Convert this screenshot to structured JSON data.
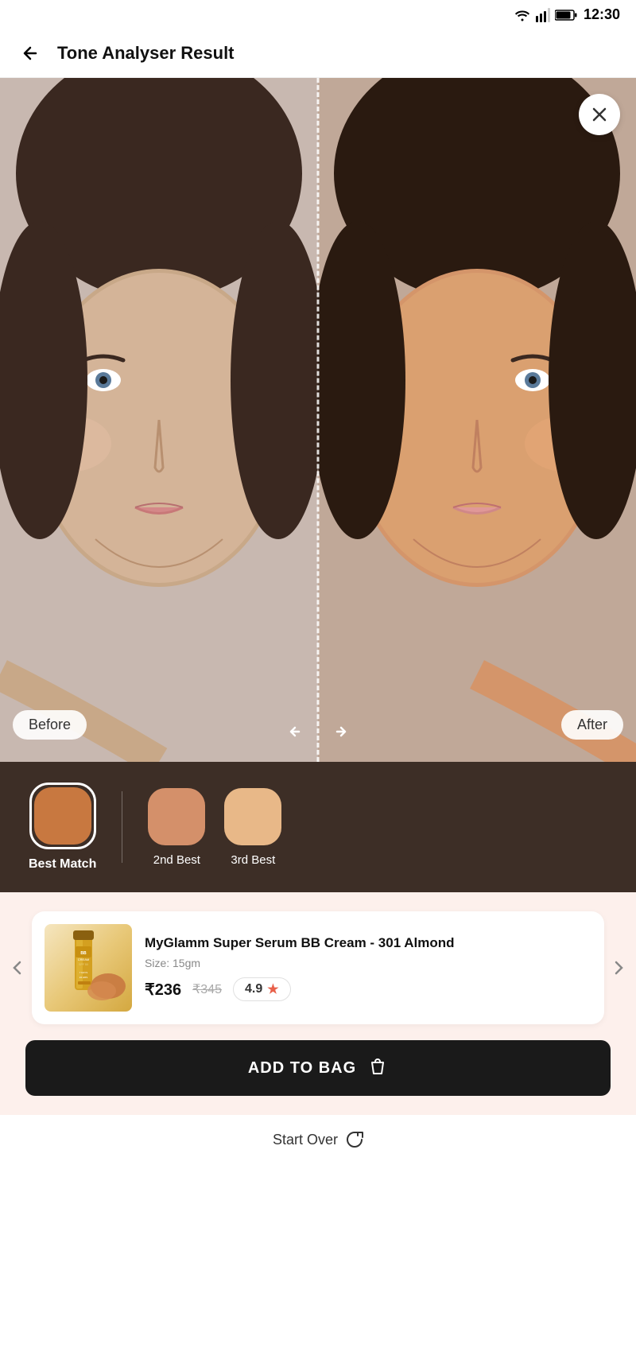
{
  "status_bar": {
    "time": "12:30",
    "wifi": "wifi",
    "signal": "signal",
    "battery": "battery"
  },
  "header": {
    "back_label": "←",
    "title": "Tone Analyser Result"
  },
  "face_view": {
    "before_label": "Before",
    "after_label": "After",
    "close_label": "×"
  },
  "swatches": {
    "best_match_label": "Best Match",
    "second_best_label": "2nd Best",
    "third_best_label": "3rd Best",
    "best_color": "#c87840",
    "second_color": "#d4906a",
    "third_color": "#e8b888"
  },
  "product": {
    "name": "MyGlamm Super Serum BB Cream - 301 Almond",
    "size": "Size: 15gm",
    "current_price": "₹236",
    "original_price": "₹345",
    "rating": "4.9"
  },
  "actions": {
    "add_to_bag": "ADD TO BAG",
    "start_over": "Start Over"
  }
}
